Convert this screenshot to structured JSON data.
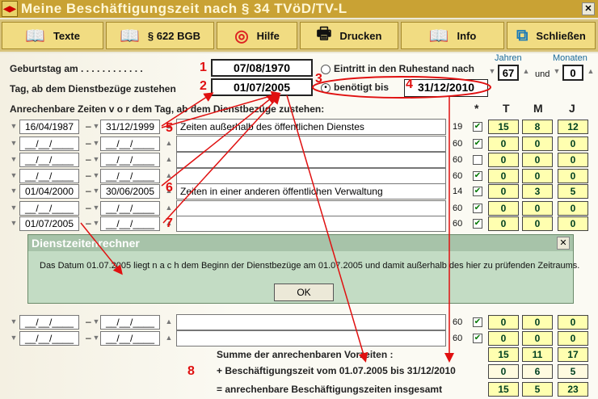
{
  "title": "Meine Beschäftigungszeit nach § 34 TVöD/TV-L",
  "toolbar": [
    {
      "label": "Texte",
      "icon": "book-icon"
    },
    {
      "label": "§ 622 BGB",
      "icon": "book-icon"
    },
    {
      "label": "Hilfe",
      "icon": "lifebuoy-icon"
    },
    {
      "label": "Drucken",
      "icon": "printer-icon"
    },
    {
      "label": "Info",
      "icon": "book-icon"
    },
    {
      "label": "Schließen",
      "icon": "exit-icon"
    }
  ],
  "form": {
    "birthday_label": "Geburtstag am . . . . . . . . . . . .",
    "birthday_value": "07/08/1970",
    "start_label": "Tag, ab dem Dienstbezüge zustehen",
    "start_value": "01/07/2005",
    "opt_retire": "Eintritt in den Ruhestand nach",
    "opt_needed": "benötigt bis",
    "needed_value": "31/12/2010",
    "jahren_label": "Jahren",
    "monaten_label": "Monaten",
    "jahren_value": "67",
    "und": "und",
    "monaten_value": "0",
    "periods_label": "Anrechenbare Zeiten   v o r   dem Tag, ab dem Dienstbezüge zustehen:",
    "star": "*",
    "col_t": "T",
    "col_m": "M",
    "col_j": "J"
  },
  "rows": [
    {
      "from": "16/04/1987",
      "to": "31/12/1999",
      "desc": "Zeiten außerhalb des öffentlichen Dienstes",
      "n": "19",
      "t": "15",
      "m": "8",
      "j": "12",
      "checked": true
    },
    {
      "from": "__/__/____",
      "to": "__/__/____",
      "desc": "",
      "n": "60",
      "t": "0",
      "m": "0",
      "j": "0",
      "checked": true
    },
    {
      "from": "__/__/____",
      "to": "__/__/____",
      "desc": "",
      "n": "60",
      "t": "0",
      "m": "0",
      "j": "0",
      "checked": false
    },
    {
      "from": "__/__/____",
      "to": "__/__/____",
      "desc": "",
      "n": "60",
      "t": "0",
      "m": "0",
      "j": "0",
      "checked": true
    },
    {
      "from": "01/04/2000",
      "to": "30/06/2005",
      "desc": "Zeiten in einer anderen öffentlichen Verwaltung",
      "n": "14",
      "t": "0",
      "m": "3",
      "j": "5",
      "checked": true
    },
    {
      "from": "__/__/____",
      "to": "__/__/____",
      "desc": "",
      "n": "60",
      "t": "0",
      "m": "0",
      "j": "0",
      "checked": true
    },
    {
      "from": "01/07/2005",
      "to": "__/__/____",
      "desc": "",
      "n": "60",
      "t": "0",
      "m": "0",
      "j": "0",
      "checked": true
    },
    {
      "from": "__/__/____",
      "to": "__/__/____",
      "desc": "",
      "n": "60",
      "t": "0",
      "m": "0",
      "j": "0",
      "checked": true
    },
    {
      "from": "__/__/____",
      "to": "__/__/____",
      "desc": "",
      "n": "60",
      "t": "0",
      "m": "0",
      "j": "0",
      "checked": true
    }
  ],
  "summary": {
    "line1": "Summe der anrechenbaren Vorzeiten :",
    "line2": "+ Beschäftigungszeit vom  01.07.2005 bis   31/12/2010",
    "line3": "= anrechenbare Beschäftigungszeiten insgesamt",
    "r1": [
      "15",
      "11",
      "17"
    ],
    "r2": [
      "0",
      "6",
      "5"
    ],
    "r3": [
      "15",
      "5",
      "23"
    ]
  },
  "dialog": {
    "title": "Dienstzeitenrechner",
    "message": "Das Datum 01.07.2005 liegt   n a c h   dem Beginn der Dienstbezüge am 01.07.2005 und damit außerhalb des hier zu prüfenden Zeitraums.",
    "ok": "OK"
  },
  "annotations": [
    "1",
    "2",
    "3",
    "4",
    "5",
    "6",
    "7",
    "8"
  ],
  "colors": {
    "title_bar": "#c9a234",
    "yellow_cell": "#ffffb0",
    "dialog": "#c3dcc4",
    "annotation": "#e01010"
  }
}
